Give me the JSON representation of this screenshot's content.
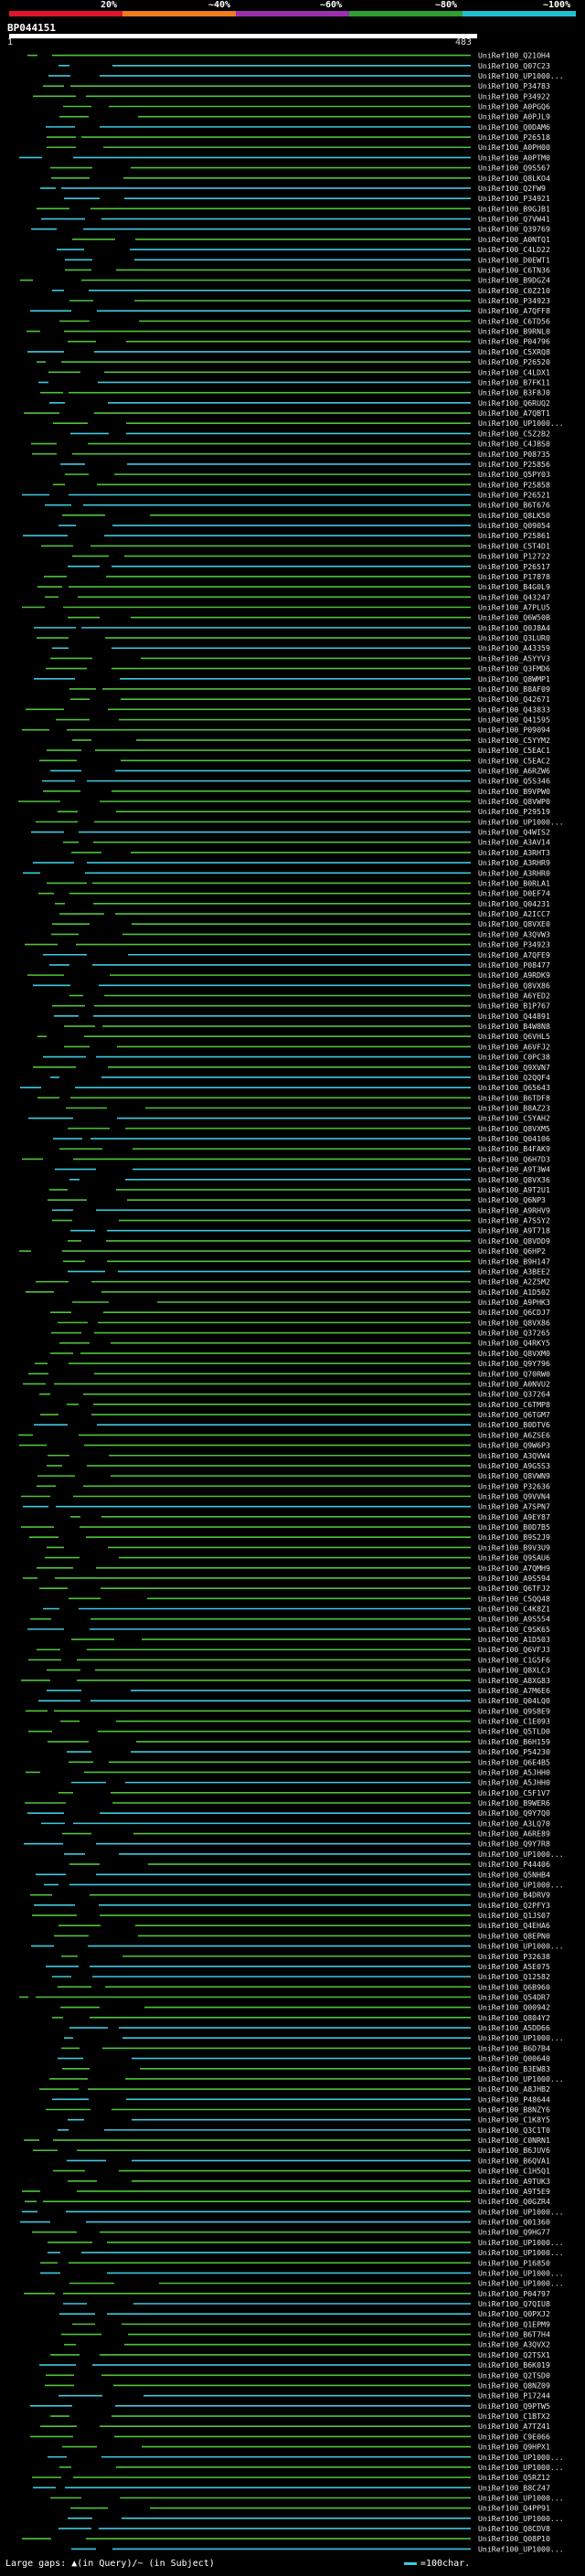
{
  "scale": {
    "ticks": [
      "20%",
      "~40%",
      "~60%",
      "~80%",
      "~100%"
    ],
    "band_colors": [
      "#e0142b",
      "#f07b1c",
      "#9b2fb0",
      "#2ea02f",
      "#21c0d0"
    ]
  },
  "query": {
    "name": "BP044151",
    "start": "1",
    "end": "483"
  },
  "colors": {
    "green": "#4fc23a",
    "cyan": "#3ec8e0",
    "line": "#555555",
    "bg": "#000000"
  },
  "hits": [
    "UniRef100_Q21OH4",
    "UniRef100_Q07C23",
    "UniRef100_UP1000...",
    "UniRef100_P34783",
    "UniRef100_P34922",
    "UniRef100_A0PGQ6",
    "UniRef100_A0PJL9",
    "UniRef100_Q0DAM6",
    "UniRef100_P26518",
    "UniRef100_A0PH00",
    "UniRef100_A0PTM0",
    "UniRef100_Q9S567",
    "UniRef100_Q8LKO4",
    "UniRef100_Q2FW9",
    "UniRef100_P34921",
    "UniRef100_B9GJB1",
    "UniRef100_Q7VW41",
    "UniRef100_Q39769",
    "UniRef100_A0NTQ1",
    "UniRef100_C4LD22",
    "UniRef100_D0EWT1",
    "UniRef100_C6TN36",
    "UniRef100_B9DGZ4",
    "UniRef100_C0Z210",
    "UniRef100_P34923",
    "UniRef100_A7QFF8",
    "UniRef100_C6TD56",
    "UniRef100_B9RNL0",
    "UniRef100_P04796",
    "UniRef100_C5XRQ8",
    "UniRef100_P26520",
    "UniRef100_C4LDX1",
    "UniRef100_B7FK11",
    "UniRef100_B3F8J0",
    "UniRef100_Q6RUQ2",
    "UniRef100_A7QBT1",
    "UniRef100_UP1000...",
    "UniRef100_C5Z2B2",
    "UniRef100_C4JBS0",
    "UniRef100_P08735",
    "UniRef100_P25856",
    "UniRef100_Q5PY03",
    "UniRef100_P25858",
    "UniRef100_P26521",
    "UniRef100_B6T676",
    "UniRef100_Q8LK50",
    "UniRef100_Q09054",
    "UniRef100_P25861",
    "UniRef100_C5T4D1",
    "UniRef100_P12722",
    "UniRef100_P26517",
    "UniRef100_P17878",
    "UniRef100_B4G0L9",
    "UniRef100_Q43247",
    "UniRef100_A7PLU5",
    "UniRef100_Q6W50B",
    "UniRef100_Q0J8A4",
    "UniRef100_Q3LUR0",
    "UniRef100_A43359",
    "UniRef100_A5YYV3",
    "UniRef100_Q3FMD6",
    "UniRef100_Q8WMP1",
    "UniRef100_B8AF09",
    "UniRef100_Q42671",
    "UniRef100_Q43833",
    "UniRef100_Q41595",
    "UniRef100_P09094",
    "UniRef100_C5YYM2",
    "UniRef100_C5EAC1",
    "UniRef100_C5EAC2",
    "UniRef100_A6RZW6",
    "UniRef100_Q5S346",
    "UniRef100_B9VPW0",
    "UniRef100_Q8VWP0",
    "UniRef100_P29519",
    "UniRef100_UP1000...",
    "UniRef100_Q4WIS2",
    "UniRef100_A3AV14",
    "UniRef100_A3RHT3",
    "UniRef100_A3RHR9",
    "UniRef100_A3RHR0",
    "UniRef100_B0RLA1",
    "UniRef100_D0EF74",
    "UniRef100_Q04231",
    "UniRef100_A2ICC7",
    "UniRef100_Q8VXE0",
    "UniRef100_A3QVW3",
    "UniRef100_P34923",
    "UniRef100_A7QFE9",
    "UniRef100_P08477",
    "UniRef100_A9RDK9",
    "UniRef100_Q8VX86",
    "UniRef100_A6YED2",
    "UniRef100_B1P767",
    "UniRef100_Q44891",
    "UniRef100_B4W8N8",
    "UniRef100_Q6VHL5",
    "UniRef100_A6VFJ2",
    "UniRef100_C0PC38",
    "UniRef100_Q9XVN7",
    "UniRef100_Q2QQF4",
    "UniRef100_Q65643",
    "UniRef100_B6TDF8",
    "UniRef100_B8AZ23",
    "UniRef100_C5YAH2",
    "UniRef100_Q8VXM5",
    "UniRef100_Q04106",
    "UniRef100_B4FAK9",
    "UniRef100_Q6H7D3",
    "UniRef100_A9T3W4",
    "UniRef100_Q8VX36",
    "UniRef100_A9T2U1",
    "UniRef100_Q6NP3",
    "UniRef100_A9RHV9",
    "UniRef100_A7S5Y2",
    "UniRef100_A9T718",
    "UniRef100_Q8VDD9",
    "UniRef100_Q6HP2",
    "UniRef100_B9H147",
    "UniRef100_A3BEE2",
    "UniRef100_A2Z5M2",
    "UniRef100_A1D502",
    "UniRef100_A9PHK3",
    "UniRef100_Q6CDJ7",
    "UniRef100_Q8VX86",
    "UniRef100_Q37265",
    "UniRef100_Q4RKY5",
    "UniRef100_Q8VXM0",
    "UniRef100_Q9Y796",
    "UniRef100_Q70RW0",
    "UniRef100_A0NVU2",
    "UniRef100_Q37264",
    "UniRef100_C6TMP8",
    "UniRef100_Q6TGM7",
    "UniRef100_B0DTV6",
    "UniRef100_A6ZSE6",
    "UniRef100_Q9W6P3",
    "UniRef100_A3QVW4",
    "UniRef100_A9G5S3",
    "UniRef100_Q8VWN9",
    "UniRef100_P32636",
    "UniRef100_Q9VVN4",
    "UniRef100_A7SPN7",
    "UniRef100_A9EY87",
    "UniRef100_B0D7B5",
    "UniRef100_B9S2J9",
    "UniRef100_B9V3U9",
    "UniRef100_Q9SAU6",
    "UniRef100_A7QMH9",
    "UniRef100_A9S594",
    "UniRef100_Q6TFJ2",
    "UniRef100_C5QQ48",
    "UniRef100_C4K8Z1",
    "UniRef100_A9S554",
    "UniRef100_C9SK65",
    "UniRef100_A1D503",
    "UniRef100_Q6VFJ3",
    "UniRef100_C1G5F6",
    "UniRef100_Q8XLC3",
    "UniRef100_A8XG83",
    "UniRef100_A7M6E6",
    "UniRef100_Q04LQ0",
    "UniRef100_Q9S8E9",
    "UniRef100_C1E093",
    "UniRef100_Q5TLD0",
    "UniRef100_B6H159",
    "UniRef100_P54230",
    "UniRef100_Q6E4B5",
    "UniRef100_A5JHH0",
    "UniRef100_A5JHH0",
    "UniRef100_C5F1V7",
    "UniRef100_B9WER6",
    "UniRef100_Q9Y7Q0",
    "UniRef100_A3LQ70",
    "UniRef100_A6RE89",
    "UniRef100_Q9Y7R8",
    "UniRef100_UP1000...",
    "UniRef100_P44406",
    "UniRef100_Q5NHB4",
    "UniRef100_UP1000...",
    "UniRef100_B4DRV9",
    "UniRef100_Q2PFY3",
    "UniRef100_Q1JS07",
    "UniRef100_Q4EHA6",
    "UniRef100_Q8EPN0",
    "UniRef100_UP1000...",
    "UniRef100_P32638",
    "UniRef100_A5E075",
    "UniRef100_Q12582",
    "UniRef100_Q6B960",
    "UniRef100_Q54DR7",
    "UniRef100_Q00942",
    "UniRef100_Q804Y2",
    "UniRef100_A5DD66",
    "UniRef100_UP1000...",
    "UniRef100_B6D7B4",
    "UniRef100_Q00640",
    "UniRef100_B3EW83",
    "UniRef100_UP1000...",
    "UniRef100_A8JHB2",
    "UniRef100_P48644",
    "UniRef100_B8NZY6",
    "UniRef100_C1K8Y5",
    "UniRef100_Q3C1T0",
    "UniRef100_C0NRN1",
    "UniRef100_B6JUV6",
    "UniRef100_B6QVA1",
    "UniRef100_C1H5Q1",
    "UniRef100_A9TUK3",
    "UniRef100_A9T5E9",
    "UniRef100_Q0GZR4",
    "UniRef100_UP1000...",
    "UniRef100_Q01360",
    "UniRef100_Q9HG77",
    "UniRef100_UP1000...",
    "UniRef100_UP1000...",
    "UniRef100_P16850",
    "UniRef100_UP1000...",
    "UniRef100_UP1000...",
    "UniRef100_P04797",
    "UniRef100_Q7QIU8",
    "UniRef100_Q0PXJ2",
    "UniRef100_Q1EPM9",
    "UniRef100_B6T7H4",
    "UniRef100_A3QVX2",
    "UniRef100_Q2TSX1",
    "UniRef100_B6K019",
    "UniRef100_Q2TSD0",
    "UniRef100_Q8NZ09",
    "UniRef100_P17244",
    "UniRef100_Q9PTW5",
    "UniRef100_C1BTX2",
    "UniRef100_A7TZ41",
    "UniRef100_C9E066",
    "UniRef100_Q9HPX1",
    "UniRef100_UP1000...",
    "UniRef100_UP1000...",
    "UniRef100_Q5RZ12",
    "UniRef100_B8CZ47",
    "UniRef100_UP1000...",
    "UniRef100_Q4PP91",
    "UniRef100_UP1000...",
    "UniRef100_Q8CDV8",
    "UniRef100_Q08P10",
    "UniRef100_UP1000..."
  ],
  "footer": {
    "gap_note": "Large gaps: ▲(in Query)/~ (in Subject)",
    "legend_label": "=100char."
  }
}
